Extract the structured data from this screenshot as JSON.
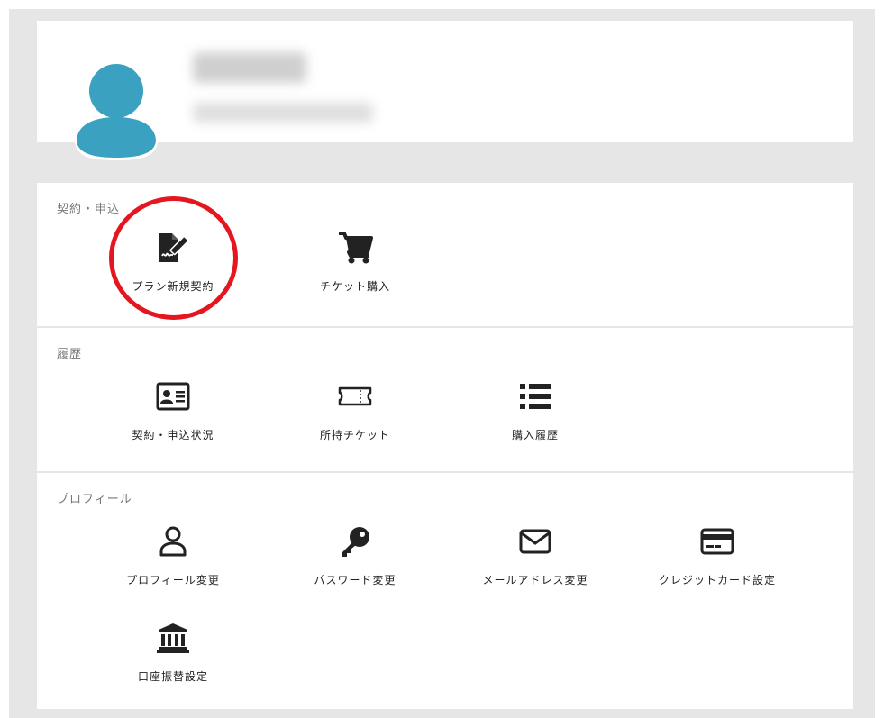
{
  "colors": {
    "avatar": "#3aa1c0",
    "highlight": "#e4161f",
    "frame": "#e6e6e6"
  },
  "sections": {
    "contract": {
      "title": "契約・申込",
      "items": [
        {
          "label": "プラン新規契約",
          "icon": "contract-sign-icon"
        },
        {
          "label": "チケット購入",
          "icon": "shopping-cart-icon"
        }
      ]
    },
    "history": {
      "title": "履歴",
      "items": [
        {
          "label": "契約・申込状況",
          "icon": "id-card-icon"
        },
        {
          "label": "所持チケット",
          "icon": "ticket-icon"
        },
        {
          "label": "購入履歴",
          "icon": "list-icon"
        }
      ]
    },
    "profile": {
      "title": "プロフィール",
      "items": [
        {
          "label": "プロフィール変更",
          "icon": "user-icon"
        },
        {
          "label": "パスワード変更",
          "icon": "key-icon"
        },
        {
          "label": "メールアドレス変更",
          "icon": "envelope-icon"
        },
        {
          "label": "クレジットカード設定",
          "icon": "credit-card-icon"
        },
        {
          "label": "口座振替設定",
          "icon": "bank-icon"
        }
      ]
    }
  }
}
